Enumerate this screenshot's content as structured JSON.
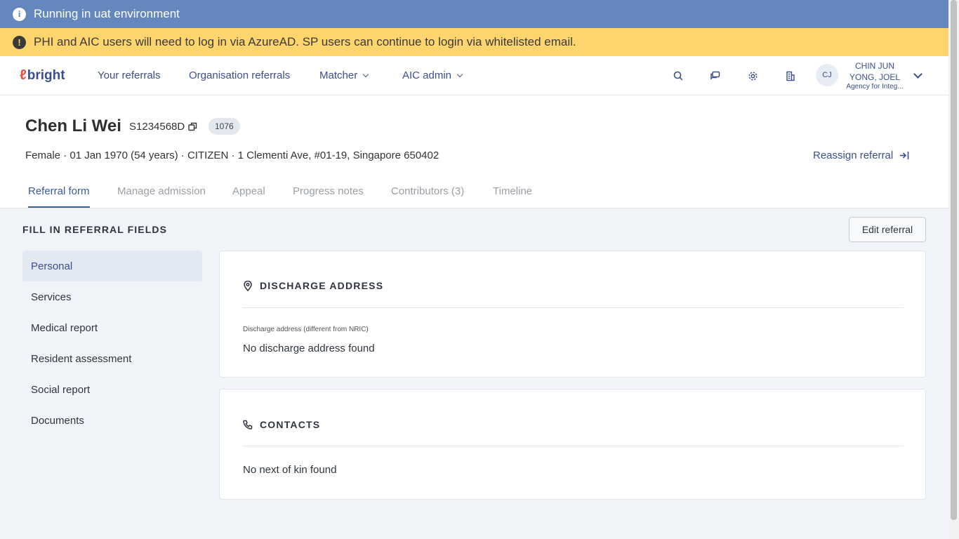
{
  "banners": {
    "environment": "Running in uat environment",
    "warning": "PHI and AIC users will need to log in via AzureAD. SP users can continue to login via whitelisted email."
  },
  "nav": {
    "logo": "bright",
    "links": [
      "Your referrals",
      "Organisation referrals",
      "Matcher",
      "AIC admin"
    ],
    "icons": [
      "search-icon",
      "chat-icon",
      "gear-icon",
      "building-icon"
    ],
    "user": {
      "initials": "CJ",
      "name_line1": "CHIN JUN",
      "name_line2": "YONG, JOEL",
      "org": "Agency for Integ..."
    }
  },
  "patient": {
    "name": "Chen Li Wei",
    "nric": "S1234568D",
    "id_badge": "1076",
    "details": "Female · 01 Jan 1970 (54 years) · CITIZEN · 1 Clementi Ave, #01-19, Singapore 650402",
    "reassign_label": "Reassign referral"
  },
  "tabs": [
    "Referral form",
    "Manage admission",
    "Appeal",
    "Progress notes",
    "Contributors (3)",
    "Timeline"
  ],
  "active_tab": "Referral form",
  "form": {
    "section_title": "FILL IN REFERRAL FIELDS",
    "edit_label": "Edit referral",
    "sidebar": [
      "Personal",
      "Services",
      "Medical report",
      "Resident assessment",
      "Social report",
      "Documents"
    ],
    "active_sidebar": "Personal"
  },
  "cards": {
    "discharge": {
      "title": "DISCHARGE ADDRESS",
      "field_label": "Discharge address (different from NRIC)",
      "field_value": "No discharge address found"
    },
    "contacts": {
      "title": "CONTACTS",
      "field_value": "No next of kin found"
    }
  },
  "colors": {
    "env_banner": "#6488bd",
    "warn_banner": "#fed56d",
    "accent": "#3b4f8c",
    "logo_mark": "#e2504a"
  }
}
